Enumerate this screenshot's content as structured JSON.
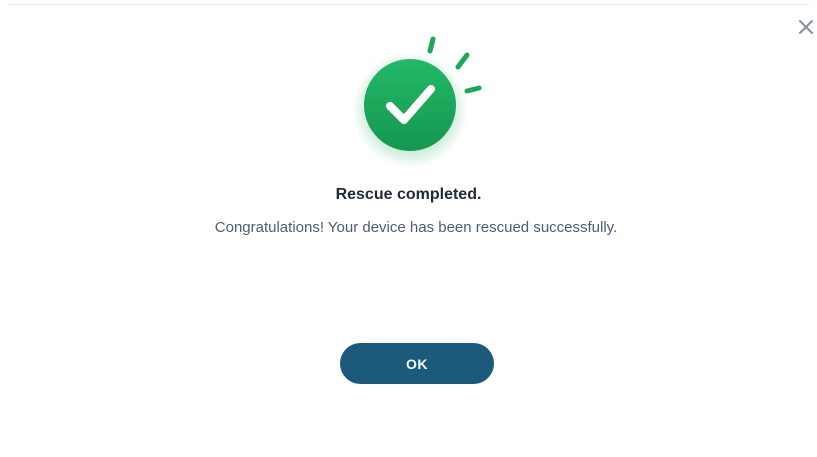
{
  "dialog": {
    "title": "Rescue completed.",
    "message": "Congratulations! Your device has been rescued successfully.",
    "ok_label": "OK",
    "close_icon": "close-icon",
    "status_icon": "checkmark-success-icon"
  },
  "colors": {
    "success_green": "#1aa85a",
    "button_blue": "#1b5a7a",
    "title_text": "#1f2a36",
    "message_text": "#4d5d74"
  }
}
